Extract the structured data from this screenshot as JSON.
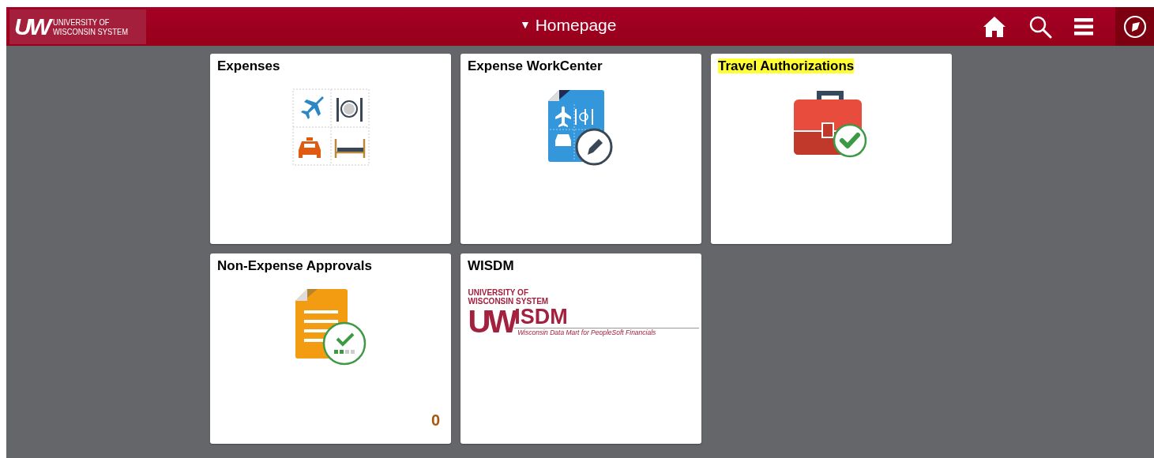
{
  "header": {
    "logo": {
      "mark": "UW",
      "line1": "UNIVERSITY OF",
      "line2": "WISCONSIN SYSTEM"
    },
    "title": "Homepage",
    "caret": "▼"
  },
  "tiles": [
    {
      "title": "Expenses",
      "highlighted": false,
      "kind": "expenses"
    },
    {
      "title": "Expense WorkCenter",
      "highlighted": false,
      "kind": "workcenter"
    },
    {
      "title": "Travel Authorizations",
      "highlighted": true,
      "kind": "briefcase"
    },
    {
      "title": "Non-Expense Approvals",
      "highlighted": false,
      "kind": "approvals",
      "count": "0"
    },
    {
      "title": "WISDM",
      "highlighted": false,
      "kind": "logo",
      "logo": {
        "line1": "UNIVERSITY OF",
        "line2": "WISCONSIN SYSTEM",
        "mark": "UW",
        "name": "ISDM",
        "tagline": "Wisconsin Data Mart for PeopleSoft Financials"
      }
    }
  ]
}
